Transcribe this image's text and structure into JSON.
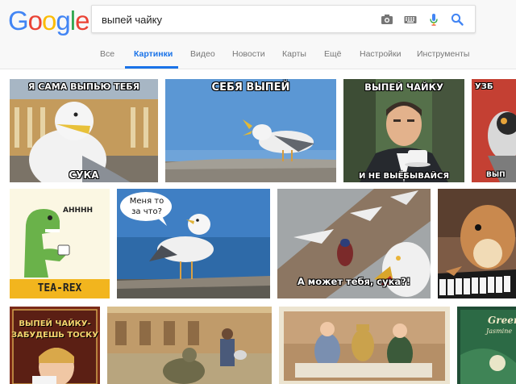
{
  "logo": {
    "letters": [
      "G",
      "o",
      "o",
      "g",
      "l",
      "e"
    ],
    "colors": [
      "#4285f4",
      "#ea4335",
      "#fbbc05",
      "#4285f4",
      "#34a853",
      "#ea4335"
    ]
  },
  "search": {
    "query": "выпей чайку",
    "icons": [
      "camera-icon",
      "keyboard-icon",
      "microphone-icon",
      "search-icon"
    ]
  },
  "tabs": [
    {
      "label": "Все",
      "active": false
    },
    {
      "label": "Картинки",
      "active": true
    },
    {
      "label": "Видео",
      "active": false
    },
    {
      "label": "Новости",
      "active": false
    },
    {
      "label": "Карты",
      "active": false
    },
    {
      "label": "Ещё",
      "active": false
    },
    {
      "label": "Настройки",
      "active": false
    },
    {
      "label": "Инструменты",
      "active": false
    }
  ],
  "images": {
    "r1c1": {
      "top": "Я САМА ВЫПЬЮ ТЕБЯ",
      "bottom": "СУКА"
    },
    "r1c2": {
      "top": "СЕБЯ ВЫПЕЙ"
    },
    "r1c3": {
      "top": "ВЫПЕЙ ЧАЙКУ",
      "bottom": "И НЕ ВЫЁБЫВАЙСЯ"
    },
    "r1c4": {
      "top": "УЗБ",
      "bottom": "ВЫП"
    },
    "r2c1": {
      "speech": "АНННН",
      "bottom": "TEA-REX"
    },
    "r2c2": {
      "bubble_line1": "Меня то",
      "bubble_line2": "за что?"
    },
    "r2c3": {
      "bottom": "А может тебя, сука?!"
    },
    "r3c1": {
      "top_line1": "ВЫПЕЙ ЧАЙКУ-",
      "top_line2": "ЗАБУДЕШЬ ТОСКУ"
    },
    "r3c4": {
      "line1": "Green",
      "line2": "Jasmine"
    }
  }
}
